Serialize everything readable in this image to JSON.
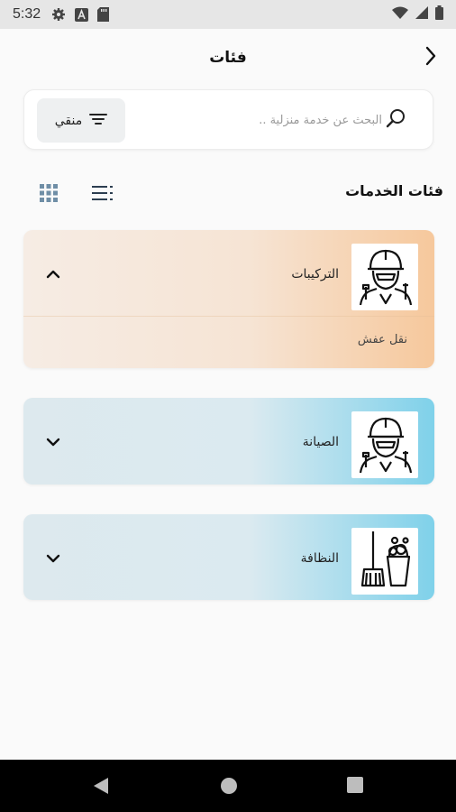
{
  "status_bar": {
    "time": "5:32",
    "icons_left": [
      "gear-icon",
      "a-icon",
      "sd-card-icon"
    ],
    "icons_right": [
      "wifi-icon",
      "signal-icon",
      "battery-icon"
    ]
  },
  "app_bar": {
    "title": "فئات",
    "back_icon": "chevron-right-icon"
  },
  "search": {
    "placeholder": "البحث عن خدمة منزلية ..",
    "filter_label": "منقي"
  },
  "section": {
    "title": "فئات الخدمات",
    "view_icons": [
      "list-view-icon",
      "grid-view-icon"
    ]
  },
  "categories": [
    {
      "label": "التركيبات",
      "icon": "technician-icon",
      "expanded": true,
      "color": "#f6c89c",
      "sub_items": [
        "نقل عفش"
      ]
    },
    {
      "label": "الصيانة",
      "icon": "technician-icon",
      "expanded": false,
      "color": "#7fd1ea"
    },
    {
      "label": "النظافة",
      "icon": "cleaning-bucket-icon",
      "expanded": false,
      "color": "#7fd1ea"
    }
  ],
  "nav_bar": {
    "buttons": [
      "back-triangle-icon",
      "home-circle-icon",
      "recents-square-icon"
    ]
  }
}
